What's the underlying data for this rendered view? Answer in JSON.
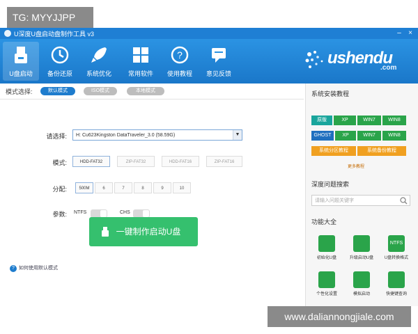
{
  "watermarks": {
    "top_left": "TG: MYYJJPP",
    "bottom_right": "www.daliannongjiale.com"
  },
  "window": {
    "title": "U深度U盘启动盘制作工具 v3",
    "controls": [
      "–",
      "×"
    ]
  },
  "toolbar": {
    "items": [
      {
        "label": "U盘启动",
        "icon": "usb-drive-icon"
      },
      {
        "label": "备份还原",
        "icon": "clock-restore-icon"
      },
      {
        "label": "系统优化",
        "icon": "rocket-icon"
      },
      {
        "label": "常用软件",
        "icon": "grid-apps-icon"
      },
      {
        "label": "使用教程",
        "icon": "help-circle-icon"
      },
      {
        "label": "意见反馈",
        "icon": "feedback-icon"
      }
    ],
    "brand": {
      "name": "ushendu",
      "suffix": ".com"
    }
  },
  "main": {
    "mode_label": "模式选择:",
    "modes": [
      "默认模式",
      "ISO模式",
      "本地模式"
    ],
    "select_label": "请选择:",
    "select_value": "H: Cu623Kingston DataTraveler_3.0 (58.59G)",
    "format_label": "模式:",
    "formats": [
      "HDD-FAT32",
      "ZIP-FAT32",
      "HDD-FAT16",
      "ZIP-FAT16"
    ],
    "alloc_label": "分配:",
    "allocs": [
      "500M",
      "6",
      "7",
      "8",
      "9",
      "10"
    ],
    "param_label": "参数:",
    "params": [
      "NTFS",
      "CHS"
    ],
    "start_button": "一键制作启动U盘",
    "help_text": "如何使用默认模式"
  },
  "sidebar": {
    "tutorial_title": "系统安装教程",
    "tutorial_rows": [
      [
        "原版",
        "XP",
        "WIN7",
        "WIN8"
      ],
      [
        "GHOST",
        "XP",
        "WIN7",
        "WIN8"
      ]
    ],
    "tutorial_extra": [
      "系统分区教程",
      "系统备份教程"
    ],
    "more": "更多教程",
    "search_title": "深度问题搜索",
    "search_placeholder": "请输入问题关键字",
    "features_title": "功能大全",
    "features": [
      "初始化U盘",
      "升级启动U盘",
      "U盘转换格式",
      "个性化设置",
      "模拟启动",
      "快捷键查询"
    ],
    "features_icon_text": [
      "",
      "",
      "NTFS",
      "",
      "",
      ""
    ]
  },
  "colors": {
    "accent": "#1f7fd4",
    "cta": "#35c06e",
    "teal": "#19a59c",
    "orange": "#f0a020"
  }
}
